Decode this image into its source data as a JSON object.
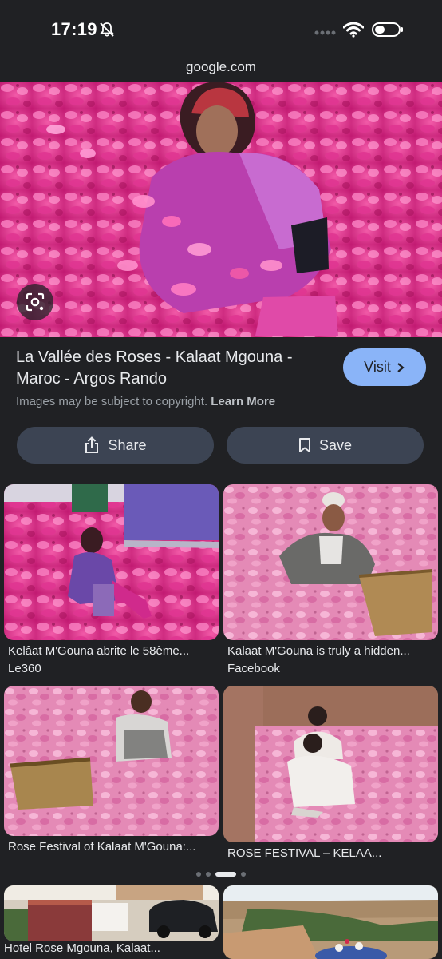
{
  "status_bar": {
    "time": "17:19"
  },
  "browser": {
    "url": "google.com"
  },
  "result": {
    "title": "La Vallée des Roses - Kalaat Mgouna - Maroc - Argos Rando",
    "visit_label": "Visit",
    "copyright_text": "Images may be subject to copyright.",
    "learn_more": "Learn More",
    "share_label": "Share",
    "save_label": "Save"
  },
  "related": [
    {
      "title": "Kelâat M'Gouna abrite le 58ème...",
      "source": "Le360"
    },
    {
      "title": "Kalaat M'Gouna is truly a hidden...",
      "source": "Facebook"
    },
    {
      "title": "Rose Festival of Kalaat M'Gouna:...",
      "source": ""
    },
    {
      "title": "ROSE FESTIVAL – KELAA...",
      "source": ""
    },
    {
      "title": "Hotel Rose Mgouna, Kalaat...",
      "source": ""
    },
    {
      "title": "",
      "source": ""
    }
  ],
  "colors": {
    "accent": "#8ab4f8",
    "background": "#202124",
    "chip": "#3c4453",
    "petals": "#e0358f"
  },
  "icons": [
    "mute-bell-icon",
    "wifi-icon",
    "battery-icon",
    "lens-icon",
    "chevron-right-icon",
    "share-icon",
    "bookmark-icon"
  ]
}
